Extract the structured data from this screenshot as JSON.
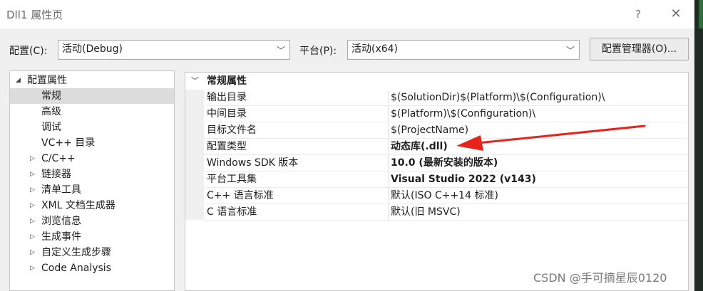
{
  "window": {
    "title": "Dll1 属性页",
    "help_label": "?",
    "close_label": "✕"
  },
  "toolbar": {
    "config_label": "配置(C):",
    "config_value": "活动(Debug)",
    "platform_label": "平台(P):",
    "platform_value": "活动(x64)",
    "config_manager_label": "配置管理器(O)..."
  },
  "tree": {
    "root": "配置属性",
    "items": [
      {
        "label": "常规",
        "selected": true,
        "expandable": false
      },
      {
        "label": "高级",
        "selected": false,
        "expandable": false
      },
      {
        "label": "调试",
        "selected": false,
        "expandable": false
      },
      {
        "label": "VC++ 目录",
        "selected": false,
        "expandable": false
      },
      {
        "label": "C/C++",
        "selected": false,
        "expandable": true
      },
      {
        "label": "链接器",
        "selected": false,
        "expandable": true
      },
      {
        "label": "清单工具",
        "selected": false,
        "expandable": true
      },
      {
        "label": "XML 文档生成器",
        "selected": false,
        "expandable": true
      },
      {
        "label": "浏览信息",
        "selected": false,
        "expandable": true
      },
      {
        "label": "生成事件",
        "selected": false,
        "expandable": true
      },
      {
        "label": "自定义生成步骤",
        "selected": false,
        "expandable": true
      },
      {
        "label": "Code Analysis",
        "selected": false,
        "expandable": true
      }
    ]
  },
  "grid": {
    "category": "常规属性",
    "rows": [
      {
        "name": "输出目录",
        "value": "$(SolutionDir)$(Platform)\\$(Configuration)\\",
        "bold": false
      },
      {
        "name": "中间目录",
        "value": "$(Platform)\\$(Configuration)\\",
        "bold": false
      },
      {
        "name": "目标文件名",
        "value": "$(ProjectName)",
        "bold": false
      },
      {
        "name": "配置类型",
        "value": "动态库(.dll)",
        "bold": true
      },
      {
        "name": "Windows SDK 版本",
        "value": "10.0 (最新安装的版本)",
        "bold": true
      },
      {
        "name": "平台工具集",
        "value": "Visual Studio 2022 (v143)",
        "bold": true
      },
      {
        "name": "C++ 语言标准",
        "value": "默认(ISO C++14 标准)",
        "bold": false
      },
      {
        "name": "C 语言标准",
        "value": "默认(旧 MSVC)",
        "bold": false
      }
    ]
  },
  "annotation": {
    "arrow_color": "#e8231c"
  },
  "watermark": "CSDN @手可摘星辰0120"
}
